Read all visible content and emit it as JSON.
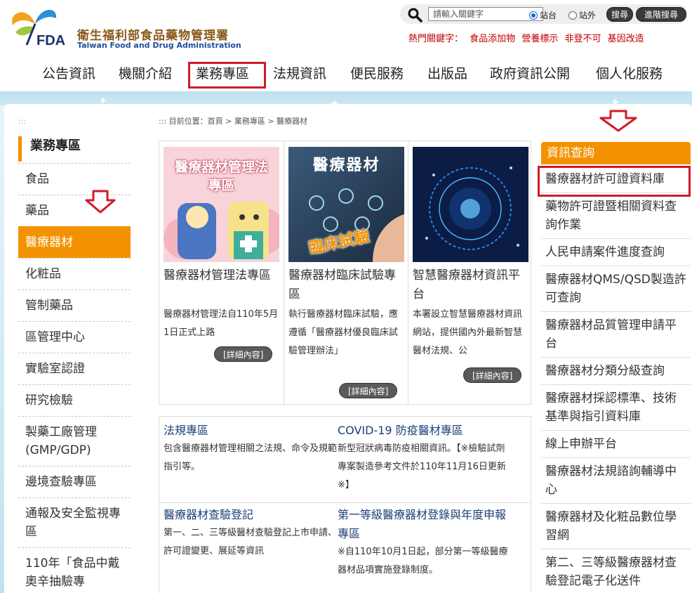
{
  "header": {
    "logo_text": "FDA",
    "org_name": "衛生福利部食品藥物管理署",
    "org_name_en": "Taiwan Food and Drug Administration",
    "search": {
      "placeholder": "請輸入關鍵字",
      "scope_site": "站台",
      "scope_outside": "站外",
      "search_label": "搜尋",
      "advanced_label": "進階搜尋"
    },
    "hot_keywords": {
      "label": "熱門關鍵字：",
      "items": [
        "食品添加物",
        "營養標示",
        "非登不可",
        "基因改造"
      ]
    },
    "nav": [
      "公告資訊",
      "機關介紹",
      "業務專區",
      "法規資訊",
      "便民服務",
      "出版品",
      "政府資訊公開",
      "個人化服務"
    ]
  },
  "breadcrumb": {
    "prefix": ":::",
    "text": "目前位置：首頁 > 業務專區 > 醫療器材"
  },
  "sidebar": {
    "accesskey": ":::",
    "title": "業務專區",
    "items": [
      "食品",
      "藥品",
      "醫療器材",
      "化粧品",
      "管制藥品",
      "區管理中心",
      "實驗室認證",
      "研究檢驗",
      "製藥工廠管理(GMP/GDP)",
      "邊境查驗專區",
      "通報及安全監視專區",
      "110年「食品中戴奧辛抽驗專"
    ]
  },
  "cards": [
    {
      "image_text_top": "醫療器材管理法",
      "image_text_bottom": "專區",
      "title": "醫療器材管理法專區",
      "desc": "醫療器材管理法自110年5月1日正式上路",
      "button": "[詳細內容]"
    },
    {
      "image_text_top": "醫療器材",
      "image_text_bottom": "臨床試驗",
      "title": "醫療器材臨床試驗專區",
      "desc": "執行醫療器材臨床試驗，應遵循「醫療器材優良臨床試驗管理辦法」",
      "button": "[詳細內容]"
    },
    {
      "title": "智慧醫療器材資訊平台",
      "desc": "本署設立智慧醫療器材資訊網站，提供國內外最新智慧醫材法規、公",
      "button": "[詳細內容]"
    }
  ],
  "news": [
    {
      "title": "法規專區",
      "desc": "包含醫療器材管理相關之法規、命令及規範指引等。"
    },
    {
      "title": "COVID-19 防疫醫材專區",
      "desc": "新型冠狀病毒防疫相關資訊。【※檢驗試劑專案製造參考文件於110年11月16日更新※】"
    },
    {
      "title": "醫療器材查驗登記",
      "desc": "第一、二、三等級醫材查驗登記上市申請、許可證變更、展延等資訊"
    },
    {
      "title": "第一等級醫療器材登錄與年度申報專區",
      "desc": "※自110年10月1日起，部分第一等級醫療器材品項實施登錄制度。"
    }
  ],
  "info": {
    "title": "資訊查詢",
    "items": [
      "醫療器材許可證資料庫",
      "藥物許可證暨相關資料查詢作業",
      "人民申請案件進度查詢",
      "醫療器材QMS/QSD製造許可查詢",
      "醫療器材品質管理申請平台",
      "醫療器材分類分級查詢",
      "醫療器材採認標準、技術基準與指引資料庫",
      "線上申辦平台",
      "醫療器材法規諮詢輔導中心",
      "醫療器材及化粧品數位學習網",
      "第二、三等級醫療器材查驗登記電子化送件"
    ]
  },
  "colors": {
    "accent_orange": "#f39200",
    "highlight_red": "#d11a2a",
    "link_blue": "#1c3f78",
    "hot_red": "#c00000"
  }
}
